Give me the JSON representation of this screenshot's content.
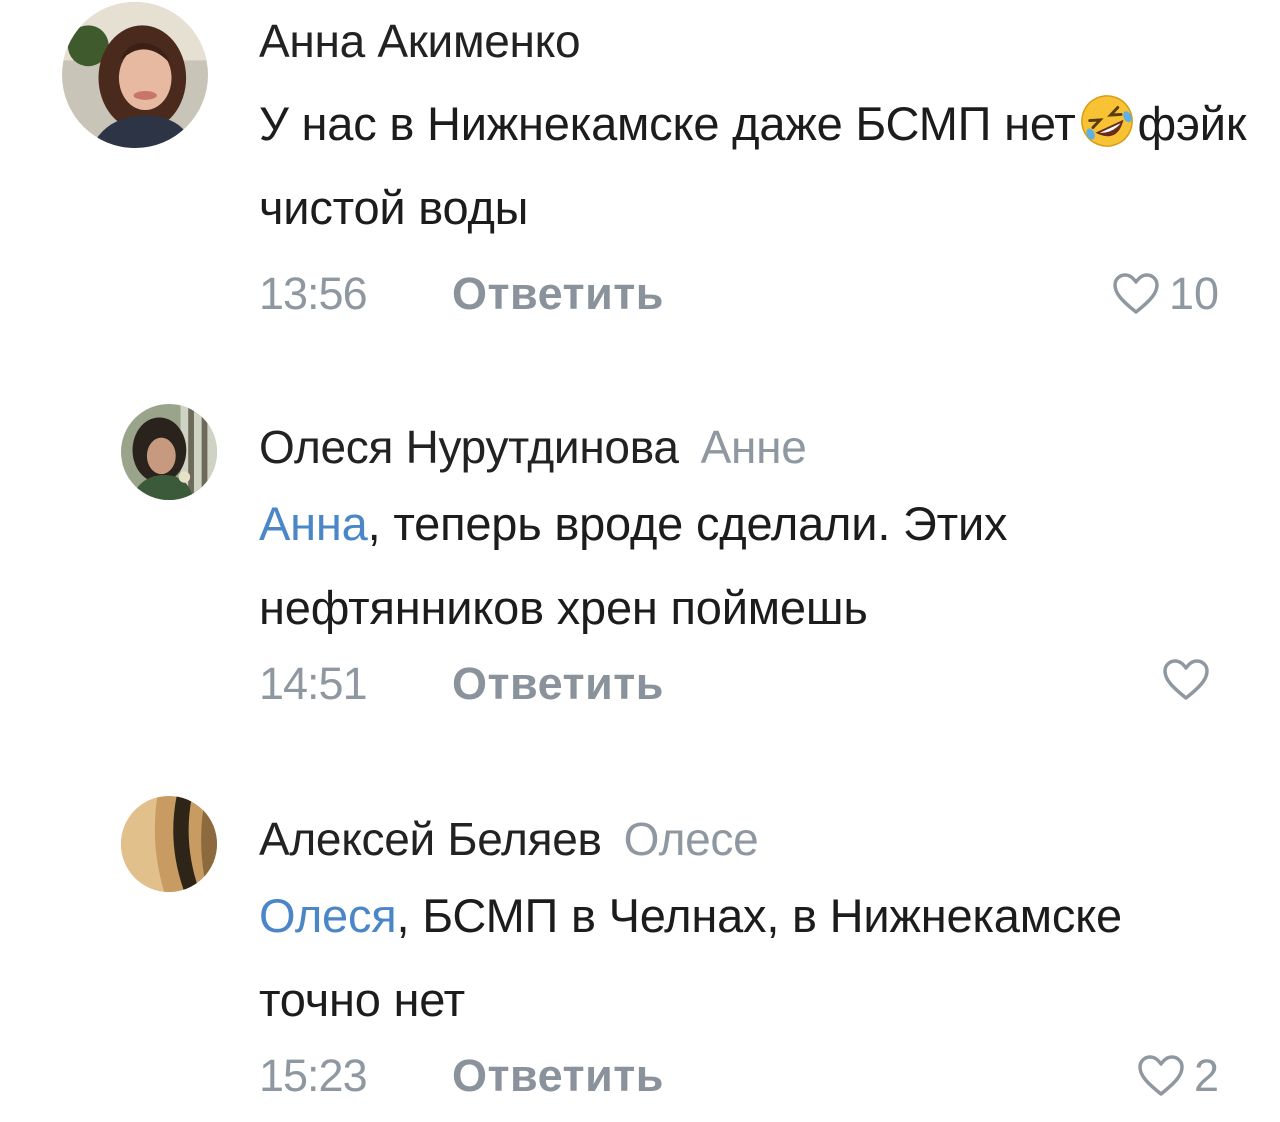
{
  "comments": [
    {
      "author": "Анна Акименко",
      "reply_to": "",
      "mention": "",
      "text_before_emoji": "У нас в Нижнекамске даже БСМП нет",
      "emoji": "rolling-on-floor-laughing",
      "text_after_emoji": "фэйк чистой воды",
      "time": "13:56",
      "reply_label": "Ответить",
      "likes": "10"
    },
    {
      "author": "Олеся Нурутдинова",
      "reply_to": "Анне",
      "mention": "Анна",
      "text": ", теперь вроде сделали. Этих нефтянников хрен поймешь",
      "time": "14:51",
      "reply_label": "Ответить",
      "likes": ""
    },
    {
      "author": "Алексей Беляев",
      "reply_to": "Олесе",
      "mention": "Олеся",
      "text": ", БСМП в Челнах, в Нижнекамске точно нет",
      "time": "15:23",
      "reply_label": "Ответить",
      "likes": "2"
    }
  ],
  "colors": {
    "mention": "#4a86c8",
    "muted": "#8f98a1",
    "text": "#1c1c1c"
  },
  "icons": {
    "like": "heart-outline-icon"
  }
}
